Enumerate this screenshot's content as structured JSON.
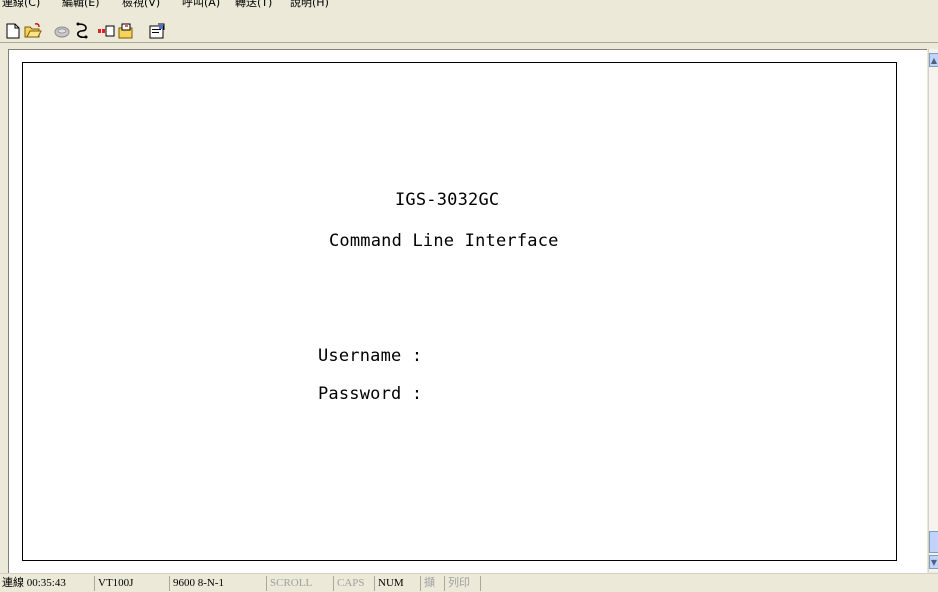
{
  "menubar": {
    "items": [
      "連線(C)",
      "編輯(E)",
      "檢視(V)",
      "呼叫(A)",
      "轉送(T)",
      "說明(H)"
    ]
  },
  "toolbar": {
    "buttons": [
      "new-document-icon",
      "open-folder-icon",
      "phone-icon",
      "disconnect-icon",
      "send-icon",
      "receive-icon",
      "properties-icon"
    ]
  },
  "terminal": {
    "title_line": "IGS-3032GC",
    "subtitle_line": "Command Line Interface",
    "username_prompt": "Username :",
    "password_prompt": "Password :"
  },
  "statusbar": {
    "connected": "連線 00:35:43",
    "emulation": "VT100J",
    "settings": "9600 8-N-1",
    "scroll": "SCROLL",
    "caps": "CAPS",
    "num": "NUM",
    "capture": "擷",
    "print_echo": "列印"
  },
  "colors": {
    "chrome": "#ece9d8",
    "terminal_bg": "#ffffff",
    "scroll_accent": "#c1d3fb"
  }
}
